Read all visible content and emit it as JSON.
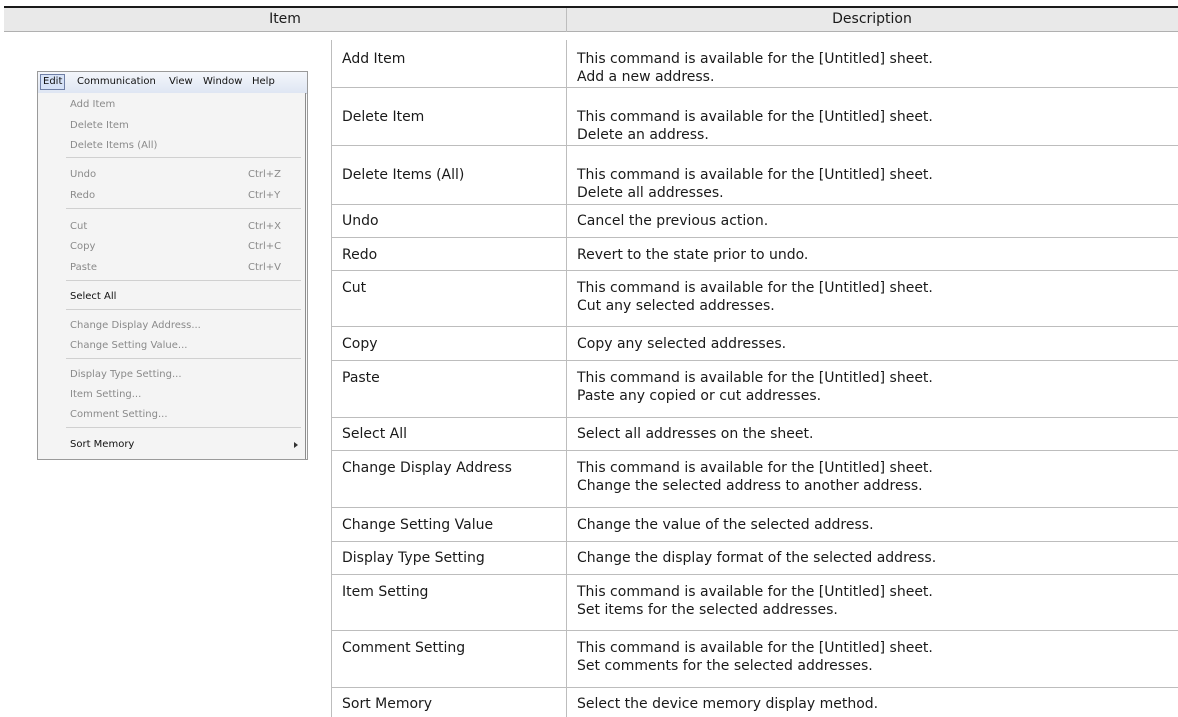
{
  "header": {
    "item": "Item",
    "description": "Description"
  },
  "menu_screenshot": {
    "menubar": [
      "Edit",
      "Communication",
      "View",
      "Window",
      "Help"
    ],
    "items": [
      {
        "label": "Add Item",
        "shortcut": ""
      },
      {
        "label": "Delete Item",
        "shortcut": ""
      },
      {
        "label": "Delete Items (All)",
        "shortcut": ""
      },
      {
        "label": "Undo",
        "shortcut": "Ctrl+Z"
      },
      {
        "label": "Redo",
        "shortcut": "Ctrl+Y"
      },
      {
        "label": "Cut",
        "shortcut": "Ctrl+X"
      },
      {
        "label": "Copy",
        "shortcut": "Ctrl+C"
      },
      {
        "label": "Paste",
        "shortcut": "Ctrl+V"
      },
      {
        "label": "Select All",
        "shortcut": ""
      },
      {
        "label": "Change Display Address...",
        "shortcut": ""
      },
      {
        "label": "Change Setting Value...",
        "shortcut": ""
      },
      {
        "label": "Display Type Setting...",
        "shortcut": ""
      },
      {
        "label": "Item Setting...",
        "shortcut": ""
      },
      {
        "label": "Comment Setting...",
        "shortcut": ""
      },
      {
        "label": "Sort Memory",
        "shortcut": ""
      }
    ]
  },
  "rows": [
    {
      "name": "Add Item",
      "desc": [
        "This command is available for the [Untitled] sheet.",
        "Add a new address."
      ]
    },
    {
      "name": "Delete Item",
      "desc": [
        "This command is available for the [Untitled] sheet.",
        "Delete an address."
      ]
    },
    {
      "name": "Delete Items (All)",
      "desc": [
        "This command is available for the [Untitled] sheet.",
        "Delete all addresses."
      ]
    },
    {
      "name": "Undo",
      "desc": [
        "Cancel the previous action."
      ]
    },
    {
      "name": "Redo",
      "desc": [
        "Revert to the state prior to undo."
      ]
    },
    {
      "name": "Cut",
      "desc": [
        "This command is available for the [Untitled] sheet.",
        "Cut any selected addresses."
      ]
    },
    {
      "name": "Copy",
      "desc": [
        "Copy any selected addresses."
      ]
    },
    {
      "name": "Paste",
      "desc": [
        "This command is available for the [Untitled] sheet.",
        "Paste any copied or cut addresses."
      ]
    },
    {
      "name": "Select All",
      "desc": [
        "Select all addresses on the sheet."
      ]
    },
    {
      "name": "Change Display Address",
      "desc": [
        "This command is available for the [Untitled] sheet.",
        "Change the selected address to another address."
      ]
    },
    {
      "name": "Change Setting Value",
      "desc": [
        "Change the value of the selected address."
      ]
    },
    {
      "name": "Display Type Setting",
      "desc": [
        "Change the display format of the selected address."
      ]
    },
    {
      "name": "Item Setting",
      "desc": [
        "This command is available for the [Untitled] sheet.",
        "Set items for the selected addresses."
      ]
    },
    {
      "name": "Comment Setting",
      "desc": [
        "This command is available for the [Untitled] sheet.",
        "Set comments for the selected addresses."
      ]
    },
    {
      "name": "Sort Memory",
      "desc": [
        "Select the device memory display method."
      ]
    }
  ]
}
